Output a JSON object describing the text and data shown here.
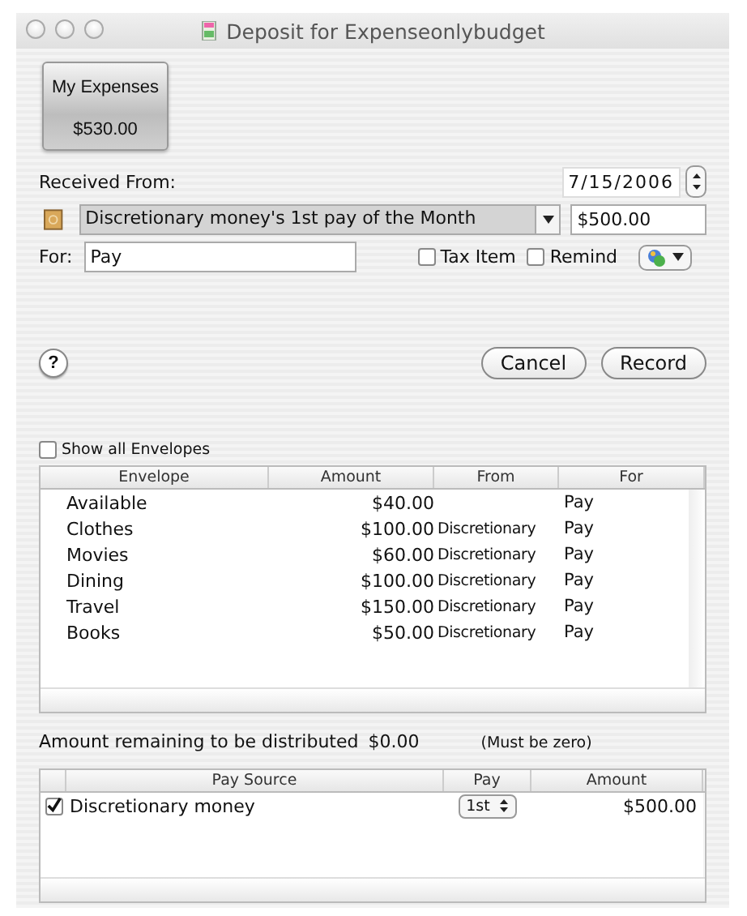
{
  "window": {
    "title": "Deposit for Expenseonlybudget"
  },
  "account": {
    "name": "My Expenses",
    "balance": "$530.00"
  },
  "received_from": {
    "label": "Received From:",
    "date": "7/15/2006",
    "source": "Discretionary money's 1st pay of the Month",
    "amount": "$500.00"
  },
  "for": {
    "label": "For:",
    "value": "Pay"
  },
  "options": [
    {
      "label": "Tax Item",
      "checked": false
    },
    {
      "label": "Remind",
      "checked": false
    }
  ],
  "help": "?",
  "buttons": [
    "Cancel",
    "Record"
  ],
  "show_all": {
    "label": "Show all Envelopes",
    "checked": false
  },
  "envelopes": {
    "columns": [
      "Envelope",
      "Amount",
      "From",
      "For"
    ],
    "rows": [
      [
        "Available",
        "$40.00",
        "",
        "Pay"
      ],
      [
        "Clothes",
        "$100.00",
        "Discretionary",
        "Pay"
      ],
      [
        "Movies",
        "$60.00",
        "Discretionary",
        "Pay"
      ],
      [
        "Dining",
        "$100.00",
        "Discretionary",
        "Pay"
      ],
      [
        "Travel",
        "$150.00",
        "Discretionary",
        "Pay"
      ],
      [
        "Books",
        "$50.00",
        "Discretionary",
        "Pay"
      ]
    ]
  },
  "remaining": {
    "label": "Amount remaining to be distributed",
    "value": "$0.00",
    "note": "(Must be zero)"
  },
  "pay_sources": {
    "columns": [
      "Pay Source",
      "Pay",
      "Amount"
    ],
    "rows": [
      {
        "name": "Discretionary money",
        "checked": true,
        "pay": "1st",
        "amount": "$500.00"
      }
    ]
  }
}
